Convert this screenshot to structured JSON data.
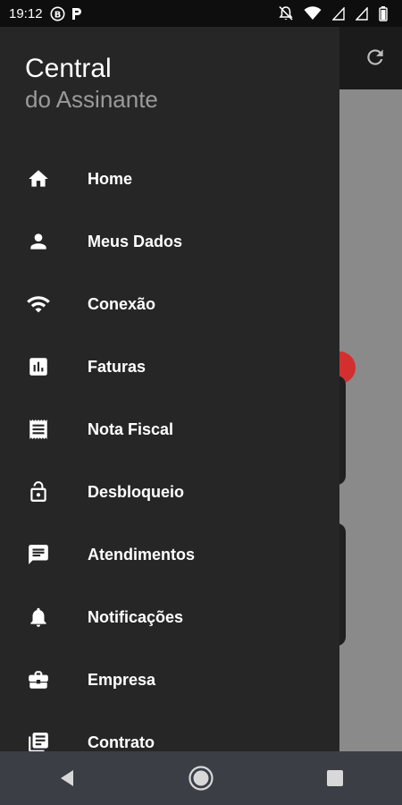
{
  "status_bar": {
    "time": "19:12",
    "icons": [
      "b-circle-icon",
      "parking-icon",
      "notifications-off-icon",
      "wifi-icon",
      "signal-icon",
      "signal-icon",
      "battery-icon"
    ]
  },
  "drawer": {
    "title": "Central",
    "subtitle": "do Assinante",
    "items": [
      {
        "label": "Home",
        "icon": "home-icon"
      },
      {
        "label": "Meus Dados",
        "icon": "person-icon"
      },
      {
        "label": "Conexão",
        "icon": "wifi-icon"
      },
      {
        "label": "Faturas",
        "icon": "bar-chart-icon"
      },
      {
        "label": "Nota Fiscal",
        "icon": "receipt-icon"
      },
      {
        "label": "Desbloqueio",
        "icon": "unlock-icon"
      },
      {
        "label": "Atendimentos",
        "icon": "chat-icon"
      },
      {
        "label": "Notificações",
        "icon": "bell-icon"
      },
      {
        "label": "Empresa",
        "icon": "briefcase-icon"
      },
      {
        "label": "Contrato",
        "icon": "document-icon"
      }
    ]
  },
  "app": {
    "topbar_icon": "refresh-icon",
    "badge_color": "#d32f2f"
  },
  "colors": {
    "drawer_bg": "#262626",
    "subtitle": "#9a9a9a",
    "navbar_bg": "#3b3f45"
  }
}
